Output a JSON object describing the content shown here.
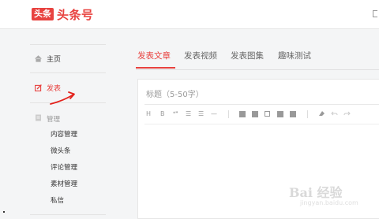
{
  "header": {
    "logo_badge": "头条",
    "logo_text": "头条号"
  },
  "sidebar": {
    "home": "主页",
    "publish": "发表",
    "manage": "管理",
    "sub_items": [
      "内容管理",
      "微头条",
      "评论管理",
      "素材管理",
      "私信"
    ]
  },
  "tabs": [
    "发表文章",
    "发表视频",
    "发表图集",
    "趣味测试"
  ],
  "editor": {
    "title_placeholder": "标题（5-50字）",
    "toolbar": [
      "H",
      "B",
      "❝❞",
      "☰",
      "☰",
      "—"
    ]
  },
  "watermark": {
    "text": "Bai 经验",
    "sub": "jingyan.baidu.com"
  },
  "colors": {
    "accent": "#e8423f",
    "annotation": "#e3211b"
  }
}
